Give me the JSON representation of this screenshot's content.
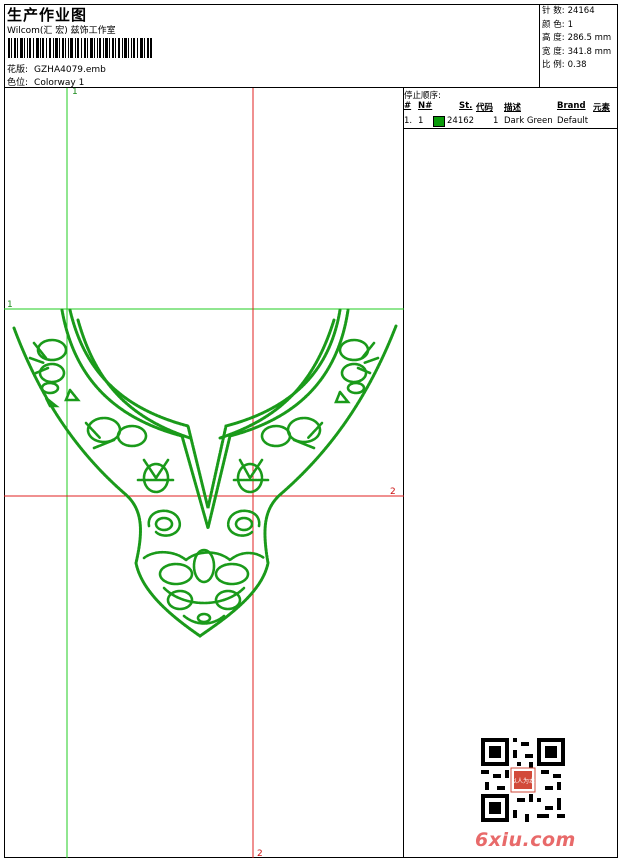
{
  "header": {
    "title": "生产作业图",
    "subtitle": "Wilcom(汇 宏) 兹饰工作室",
    "design_label": "花版:",
    "design_value": "GZHA4079.emb",
    "colorway_label": "色位:",
    "colorway_value": "Colorway 1"
  },
  "stats": [
    {
      "label": "针 数:",
      "value": "24164"
    },
    {
      "label": "颜 色:",
      "value": "1"
    },
    {
      "label": "高 度:",
      "value": "286.5 mm"
    },
    {
      "label": "宽 度:",
      "value": "341.8 mm"
    },
    {
      "label": "比 例:",
      "value": "0.38"
    }
  ],
  "stop_sequence": {
    "title": "停止顺序:",
    "columns": [
      "#",
      "N#",
      "St.",
      "代码",
      "描述",
      "Brand",
      "元素"
    ],
    "rows": [
      {
        "index": "1.",
        "needle": "1",
        "stitches": "24162",
        "code": "1",
        "description": "Dark Green",
        "brand": "Default",
        "color": "#0a9b0a"
      }
    ]
  },
  "guides": {
    "green_top": "1",
    "green_left": "1",
    "red_right": "2",
    "red_bottom": "2"
  },
  "colors": {
    "thread": "#1a9a1a",
    "guide_green": "#22cc22",
    "guide_red": "#e02020"
  },
  "watermark": "6xiu.com",
  "stamp_text": "以人为本"
}
